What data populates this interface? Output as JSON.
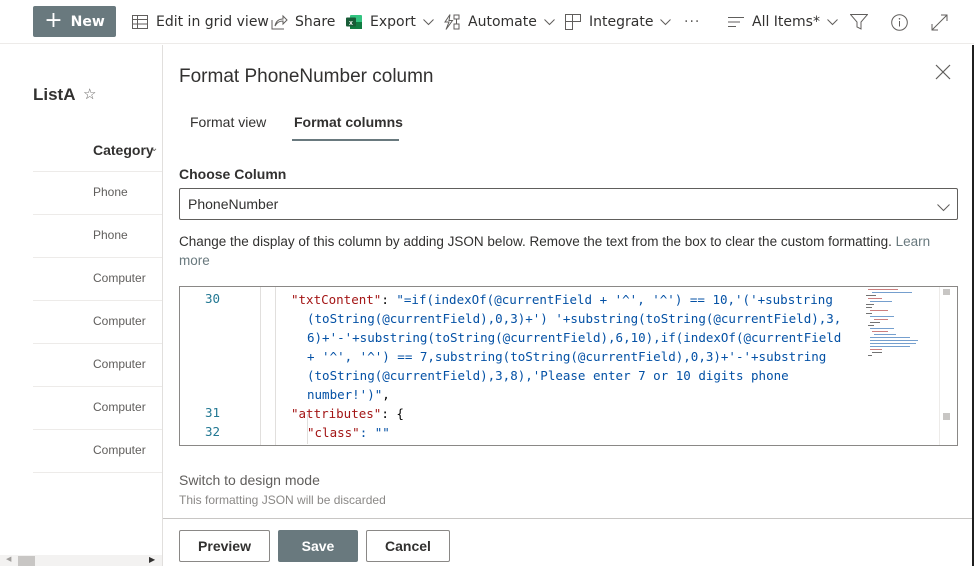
{
  "toolbar": {
    "new_label": "New",
    "edit_grid_label": "Edit in grid view",
    "share_label": "Share",
    "export_label": "Export",
    "automate_label": "Automate",
    "integrate_label": "Integrate",
    "more_label": "···",
    "view_label": "All Items*",
    "icons": [
      "plus-icon",
      "grid-icon",
      "share-icon",
      "excel-icon",
      "automate-icon",
      "integrate-icon",
      "more-icon",
      "view-lines-icon",
      "filter-icon",
      "info-icon",
      "expand-icon"
    ]
  },
  "list": {
    "title": "ListA",
    "star_glyph": "☆",
    "column_header": "Category",
    "rows": [
      "Phone",
      "Phone",
      "Computer",
      "Computer",
      "Computer",
      "Computer",
      "Computer"
    ]
  },
  "panel": {
    "title": "Format PhoneNumber column",
    "tabs": [
      {
        "label": "Format view",
        "active": false
      },
      {
        "label": "Format columns",
        "active": true
      }
    ],
    "choose_column_label": "Choose Column",
    "column_value": "PhoneNumber",
    "description": "Change the display of this column by adding JSON below. Remove the text from the box to clear the custom formatting.",
    "learn_more": "Learn more",
    "editor": {
      "lines": [
        {
          "number": "30",
          "key": "\"txtContent\"",
          "value_lines": [
            "\"=if(indexOf(@currentField + '^', '^') == 10,'('+substring",
            "(toString(@currentField),0,3)+') '+substring(toString(@currentField),3,",
            "6)+'-'+substring(toString(@currentField),6,10),if(indexOf(@currentField",
            "+ '^', '^') == 7,substring(toString(@currentField),0,3)+'-'+substring",
            "(toString(@currentField),3,8),'Please enter 7 or 10 digits phone",
            "number!')\""
          ]
        },
        {
          "number": "31",
          "key": "\"attributes\"",
          "rest": ": {"
        },
        {
          "number": "32",
          "key": "\"class\"",
          "rest": ": \"\""
        }
      ]
    },
    "design_mode_link": "Switch to design mode",
    "design_mode_note": "This formatting JSON will be discarded",
    "buttons": {
      "preview": "Preview",
      "save": "Save",
      "cancel": "Cancel"
    }
  },
  "colors": {
    "accent": "#69797e",
    "json_key": "#a31515",
    "json_string": "#0451a5",
    "line_number": "#237893",
    "excel_green": "#217346"
  }
}
